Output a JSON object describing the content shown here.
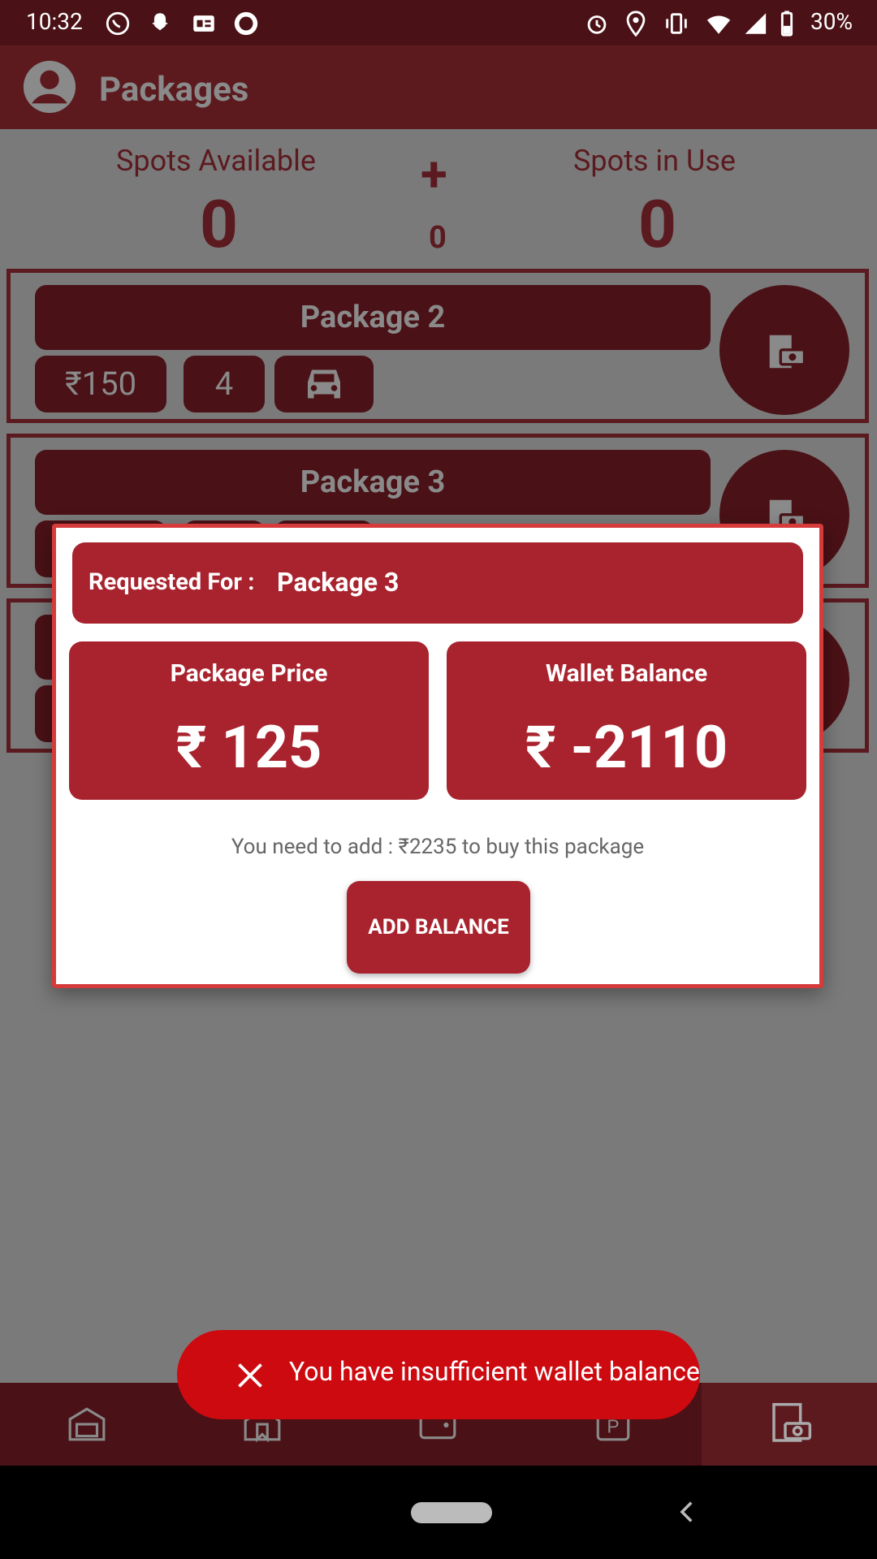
{
  "status_bar": {
    "time": "10:32",
    "battery": "30%"
  },
  "app_bar": {
    "title": "Packages"
  },
  "spots": {
    "available_label": "Spots Available",
    "available_value": "0",
    "plus_symbol": "+",
    "pending_value": "0",
    "in_use_label": "Spots in Use",
    "in_use_value": "0"
  },
  "packages": [
    {
      "title": "Package 2",
      "price": "₹150",
      "count": "4"
    },
    {
      "title": "Package 3"
    }
  ],
  "dialog": {
    "requested_label": "Requested For :",
    "requested_value": "Package 3",
    "package_price_label": "Package Price",
    "package_price_value": "₹ 125",
    "wallet_label": "Wallet Balance",
    "wallet_value": "₹ -2110",
    "note": "You need to add : ₹2235 to buy this package",
    "add_button": "ADD BALANCE"
  },
  "toast": {
    "message": "You have insufficient wallet balance"
  },
  "colors": {
    "accent": "#a8232e",
    "toast": "#cc0a10",
    "appbar": "#5c1a1f"
  }
}
